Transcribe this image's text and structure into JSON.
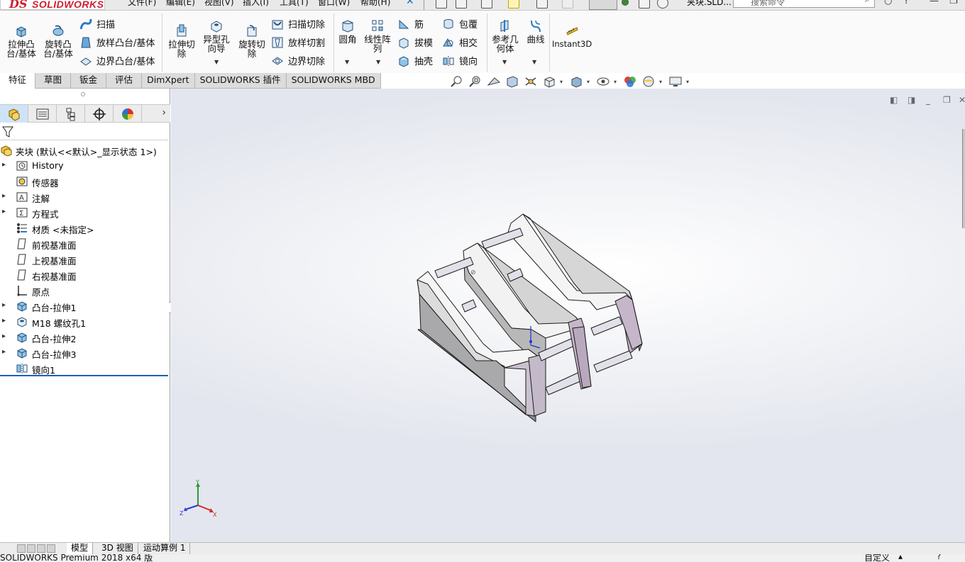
{
  "app": {
    "logo_ds": "DS",
    "logo_text": "SOLIDWORKS",
    "document_title": "夹块.SLD...",
    "search_placeholder": "搜索命令"
  },
  "menu": [
    "文件(F)",
    "编辑(E)",
    "视图(V)",
    "插入(I)",
    "工具(T)",
    "窗口(W)",
    "帮助(H)"
  ],
  "commands": {
    "extrude_boss": "拉伸凸\n台/基体",
    "revolve_boss": "旋转凸\n台/基体",
    "sweep": "扫描",
    "loft_boss": "放样凸台/基体",
    "boundary_boss": "边界凸台/基体",
    "extrude_cut": "拉伸切\n除",
    "hole_wizard": "异型孔\n向导",
    "revolve_cut": "旋转切\n除",
    "sweep_cut": "扫描切除",
    "loft_cut": "放样切割",
    "boundary_cut": "边界切除",
    "fillet": "圆角",
    "linear_pattern": "线性阵\n列",
    "rib": "筋",
    "draft": "拔模",
    "shell": "抽壳",
    "wrap": "包覆",
    "intersect": "相交",
    "mirror": "镜向",
    "ref_geometry": "参考几\n何体",
    "curves": "曲线",
    "instant3d": "Instant3D"
  },
  "tabs": [
    "特征",
    "草图",
    "钣金",
    "评估",
    "DimXpert",
    "SOLIDWORKS 插件",
    "SOLIDWORKS MBD"
  ],
  "active_tab": "特征",
  "tree": {
    "root": "夹块  (默认<<默认>_显示状态 1>)",
    "items": [
      {
        "label": "History",
        "icon": "history-icon",
        "expandable": true
      },
      {
        "label": "传感器",
        "icon": "sensor-icon",
        "expandable": false
      },
      {
        "label": "注解",
        "icon": "annotations-icon",
        "expandable": true
      },
      {
        "label": "方程式",
        "icon": "equations-icon",
        "expandable": true
      },
      {
        "label": "材质 <未指定>",
        "icon": "material-icon",
        "expandable": false
      },
      {
        "label": "前视基准面",
        "icon": "plane-icon",
        "expandable": false
      },
      {
        "label": "上视基准面",
        "icon": "plane-icon",
        "expandable": false
      },
      {
        "label": "右视基准面",
        "icon": "plane-icon",
        "expandable": false
      },
      {
        "label": "原点",
        "icon": "origin-icon",
        "expandable": false
      },
      {
        "label": "凸台-拉伸1",
        "icon": "boss-extrude-icon",
        "expandable": true
      },
      {
        "label": "M18 螺纹孔1",
        "icon": "hole-icon",
        "expandable": true
      },
      {
        "label": "凸台-拉伸2",
        "icon": "boss-extrude-icon",
        "expandable": true
      },
      {
        "label": "凸台-拉伸3",
        "icon": "boss-extrude-icon",
        "expandable": true
      },
      {
        "label": "镜向1",
        "icon": "mirror-icon",
        "expandable": false
      }
    ]
  },
  "triad": {
    "x": "X",
    "y": "Y",
    "z": "Z"
  },
  "bottom_tabs": [
    "模型",
    "3D 视图",
    "运动算例 1"
  ],
  "status": {
    "left": "SOLIDWORKS Premium 2018 x64 版",
    "right": "自定义"
  }
}
